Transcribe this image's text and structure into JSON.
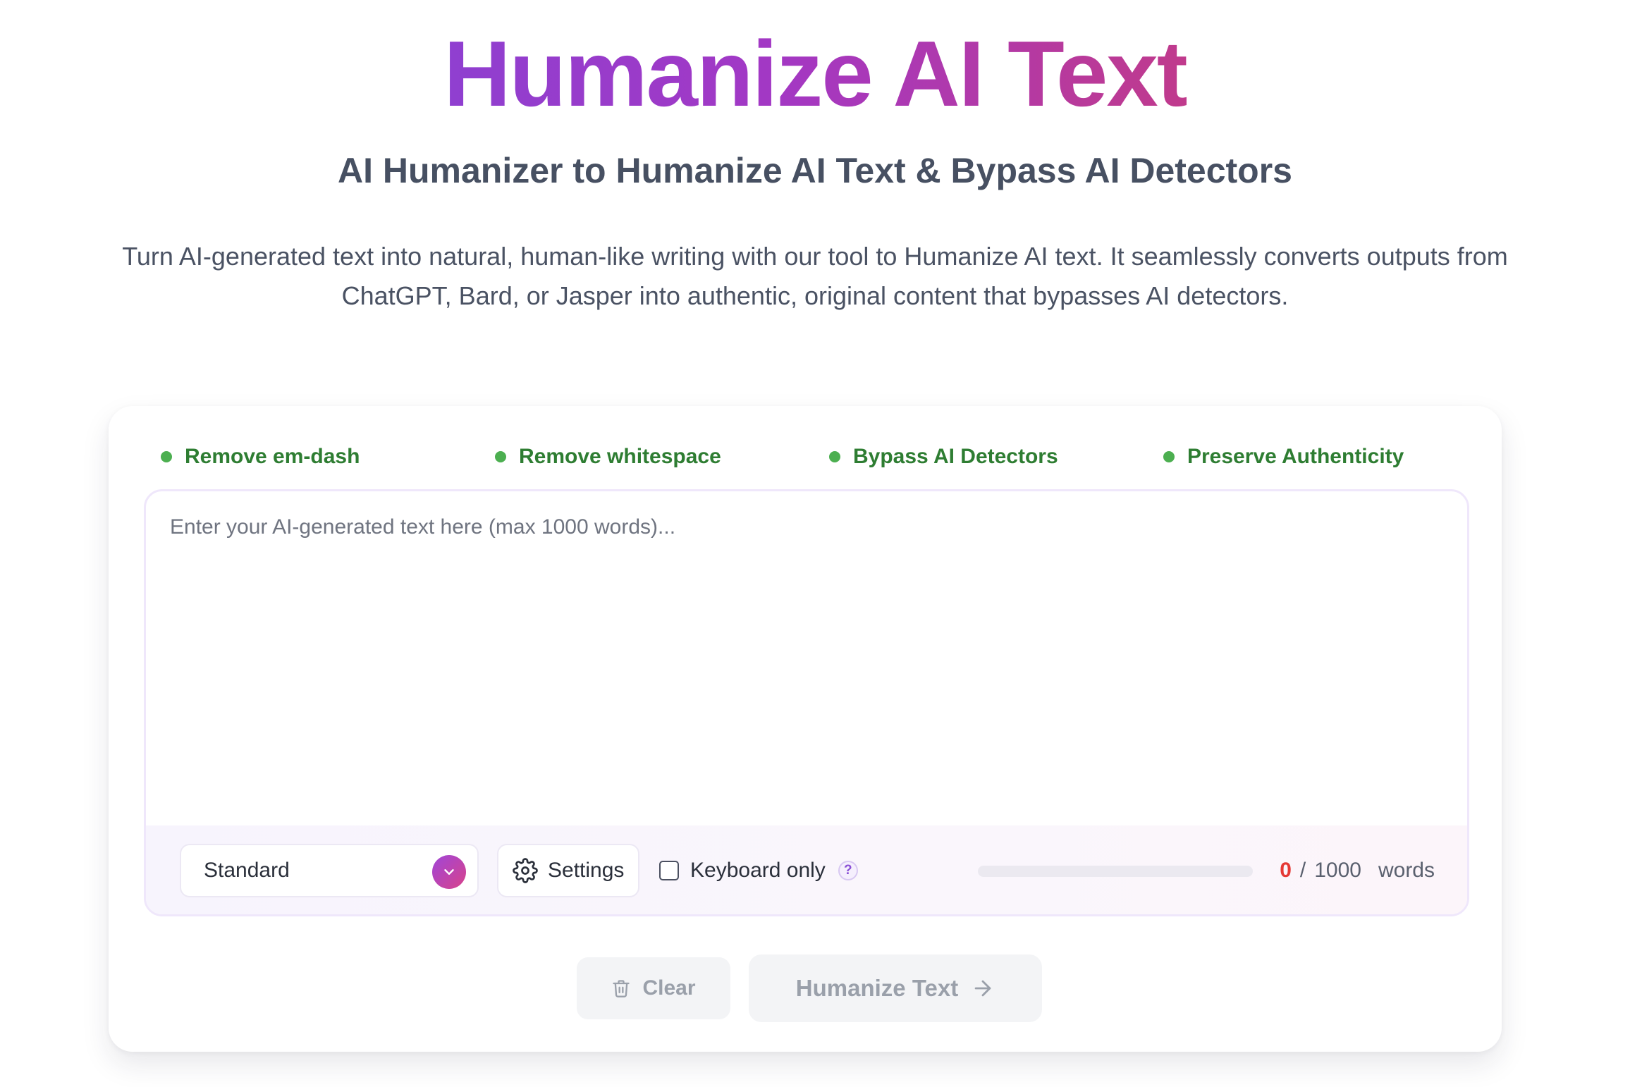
{
  "hero": {
    "title": "Humanize AI Text",
    "subtitle": "AI Humanizer to Humanize AI Text & Bypass AI Detectors",
    "description": "Turn AI-generated text into natural, human-like writing with our tool to Humanize AI text. It seamlessly converts outputs from ChatGPT, Bard, or Jasper into authentic, original content that bypasses AI detectors."
  },
  "features": [
    {
      "label": "Remove em-dash"
    },
    {
      "label": "Remove whitespace"
    },
    {
      "label": "Bypass AI Detectors"
    },
    {
      "label": "Preserve Authenticity"
    }
  ],
  "editor": {
    "value": "",
    "placeholder": "Enter your AI-generated text here (max 1000 words)..."
  },
  "toolbar": {
    "mode": "Standard",
    "settings_label": "Settings",
    "keyboard_only_label": "Keyboard only",
    "keyboard_only_checked": false,
    "help_glyph": "?",
    "word_count": "0",
    "separator": "/",
    "word_limit": "1000",
    "words_label": "words",
    "progress_fraction": 0
  },
  "actions": {
    "clear_label": "Clear",
    "humanize_label": "Humanize Text"
  },
  "colors": {
    "title_gradient_start": "#8f3fd0",
    "title_gradient_end": "#c03a8c",
    "feature_dot": "#4caf50",
    "feature_text": "#2e7d32",
    "count_text": "#e53935",
    "disabled_button_bg": "#f3f4f6"
  },
  "icons": {
    "mode_dropdown": "chevron-down-icon",
    "settings": "gear-icon",
    "help": "question-icon",
    "clear": "trash-icon",
    "humanize": "arrow-right-icon"
  }
}
